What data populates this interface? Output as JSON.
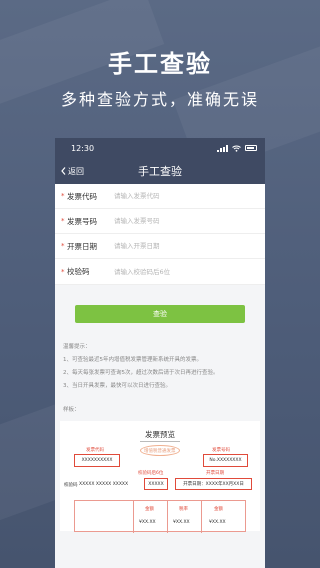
{
  "hero": {
    "title": "手工查验",
    "subtitle": "多种查验方式，准确无误"
  },
  "status_bar": {
    "time": "12:30"
  },
  "nav": {
    "back_label": "返回",
    "title": "手工查验"
  },
  "form": {
    "rows": [
      {
        "label": "发票代码",
        "placeholder": "请输入发票代码"
      },
      {
        "label": "发票号码",
        "placeholder": "请输入发票号码"
      },
      {
        "label": "开票日期",
        "placeholder": "请输入开票日期"
      },
      {
        "label": "校验码",
        "placeholder": "请输入校验码后6位"
      }
    ]
  },
  "check_button": "查验",
  "tips": {
    "heading": "温馨提示：",
    "items": [
      "1、可查验最近5年内增值税发票管理新系统开具的发票。",
      "2、每天每张发票可查询5次，超过次数后请于次日再进行查验。",
      "3、当日开具发票，最快可以次日进行查验。"
    ]
  },
  "sample": {
    "label": "样板：",
    "title": "发票预览",
    "code_label": "发票代码",
    "code_value": "XXXXXXXXXX",
    "watermark": "增值税普通发票",
    "number_label": "发票号码",
    "number_value": "No.XXXXXXXX",
    "verify_label": "校验码后6位",
    "verify_prefix": "校验码",
    "verify_value_plain": "XXXXX XXXXX XXXXX",
    "verify_value_boxed": "XXXXX",
    "date_label": "开票日期",
    "date_value": "开票日期：XXXX年XX月XX日",
    "columns": [
      "金额",
      "税率",
      "金额"
    ],
    "values": [
      "¥XX.XX",
      "¥XX.XX",
      "¥XX.XX"
    ]
  },
  "colors": {
    "accent_green": "#7dc242",
    "navy": "#3f4a63",
    "red": "#e04a3a"
  }
}
